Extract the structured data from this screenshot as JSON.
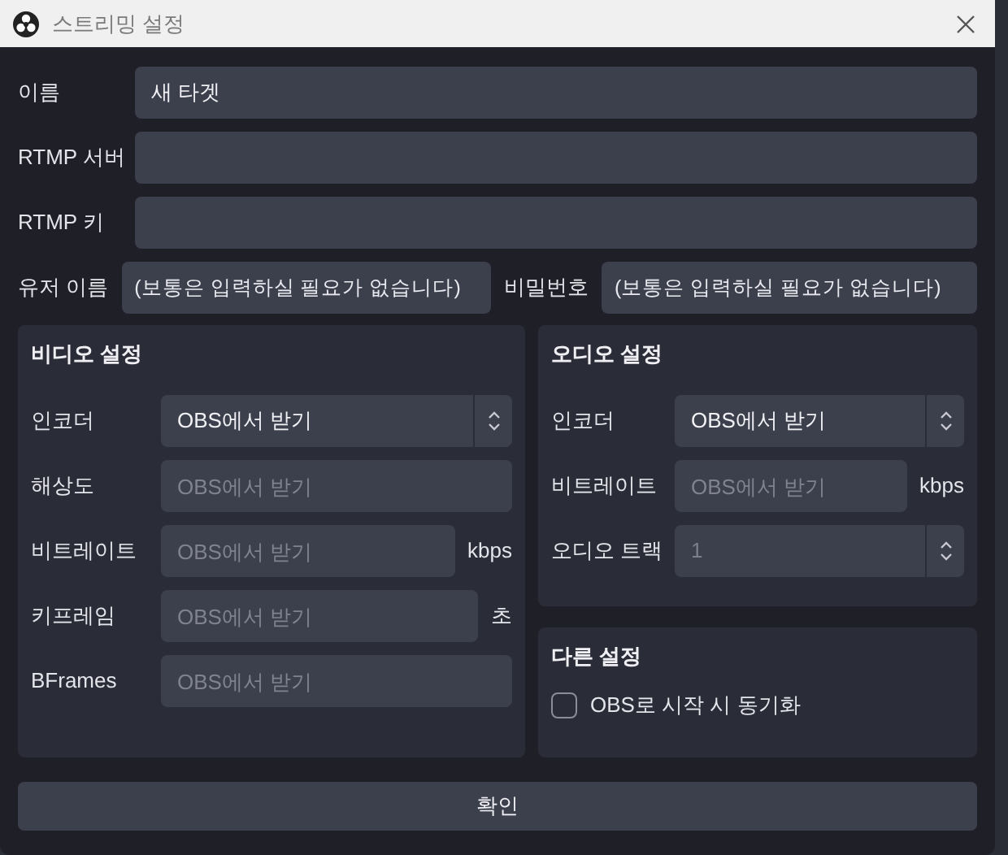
{
  "window": {
    "title": "스트리밍 설정"
  },
  "fields": [
    {
      "label": "이름",
      "value": "새 타겟"
    },
    {
      "label": "RTMP 서버"
    },
    {
      "label": "RTMP 키"
    }
  ],
  "credentials": [
    {
      "label": "유저 이름",
      "placeholder": "(보통은 입력하실 필요가 없습니다)"
    },
    {
      "label": "비밀번호",
      "placeholder": "(보통은 입력하실 필요가 없습니다)"
    }
  ],
  "video": {
    "title": "비디오 설정",
    "rows": [
      {
        "kind": "combo",
        "label": "인코더",
        "value": "OBS에서 받기"
      },
      {
        "kind": "input",
        "label": "해상도",
        "placeholder": "OBS에서 받기"
      },
      {
        "kind": "input",
        "label": "비트레이트",
        "placeholder": "OBS에서 받기",
        "unit": "kbps"
      },
      {
        "kind": "input",
        "label": "키프레임",
        "placeholder": "OBS에서 받기",
        "unit": "초"
      },
      {
        "kind": "input",
        "label": "BFrames",
        "placeholder": "OBS에서 받기"
      }
    ]
  },
  "audio": {
    "title": "오디오 설정",
    "rows": [
      {
        "kind": "combo",
        "label": "인코더",
        "value": "OBS에서 받기"
      },
      {
        "kind": "input",
        "label": "비트레이트",
        "placeholder": "OBS에서 받기",
        "unit": "kbps"
      },
      {
        "kind": "spin",
        "label": "오디오 트랙",
        "value": "1",
        "disabled": true
      }
    ]
  },
  "other": {
    "title": "다른 설정",
    "checkbox": {
      "label": "OBS로 시작 시 동기화",
      "checked": false
    }
  },
  "confirm_button": "확인"
}
